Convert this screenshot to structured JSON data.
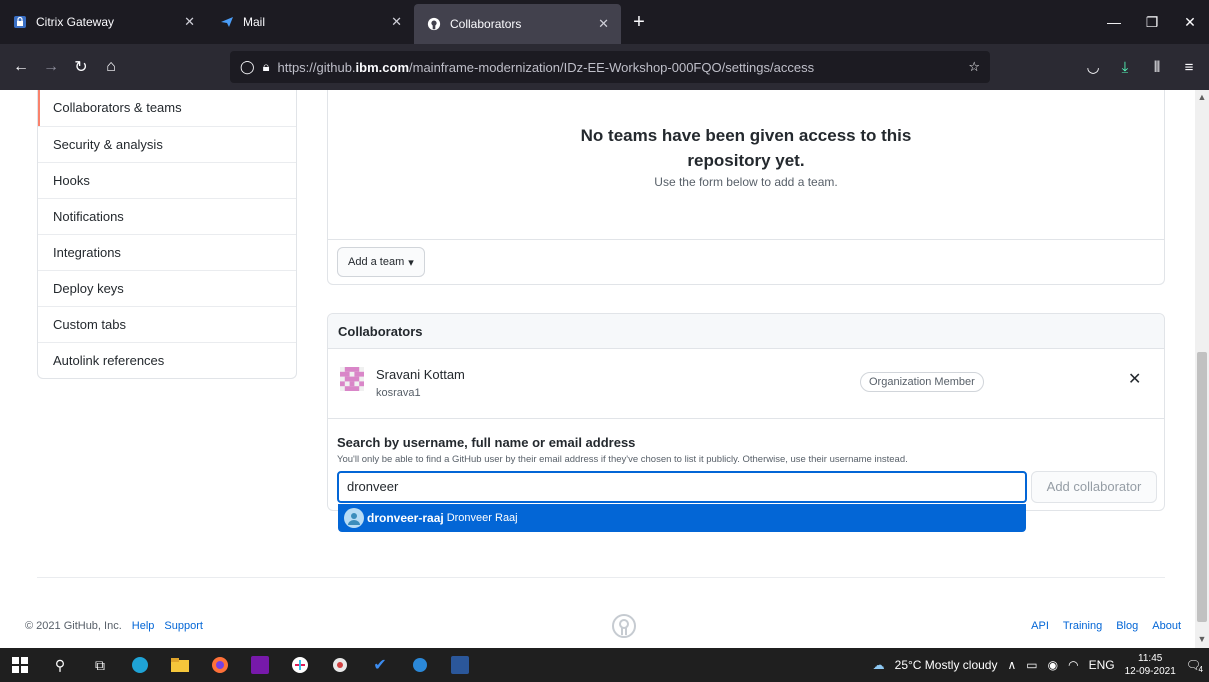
{
  "browser": {
    "tabs": [
      {
        "title": "Citrix Gateway",
        "icon": "lock-icon"
      },
      {
        "title": "Mail",
        "icon": "mail-icon"
      },
      {
        "title": "Collaborators",
        "icon": "github-icon",
        "active": true
      }
    ],
    "url_prefix": "https://github.",
    "url_domain": "ibm.com",
    "url_path": "/mainframe-modernization/IDz-EE-Workshop-000FQO/settings/access"
  },
  "sidebar": {
    "items": [
      {
        "label": "Collaborators & teams"
      },
      {
        "label": "Security & analysis"
      },
      {
        "label": "Hooks"
      },
      {
        "label": "Notifications"
      },
      {
        "label": "Integrations"
      },
      {
        "label": "Deploy keys"
      },
      {
        "label": "Custom tabs"
      },
      {
        "label": "Autolink references"
      }
    ]
  },
  "teams": {
    "empty_title": "No teams have been given access to this repository yet.",
    "empty_subtitle": "Use the form below to add a team.",
    "add_team_label": "Add a team"
  },
  "collaborators": {
    "heading": "Collaborators",
    "member": {
      "name": "Sravani Kottam",
      "login": "kosrava1",
      "badge": "Organization Member"
    },
    "search_label": "Search by username, full name or email address",
    "search_note": "You'll only be able to find a GitHub user by their email address if they've chosen to list it publicly. Otherwise, use their username instead.",
    "search_value": "dronveer",
    "add_button": "Add collaborator",
    "suggestion": {
      "login": "dronveer-raaj",
      "name": "Dronveer Raaj"
    }
  },
  "footer": {
    "copyright": "© 2021 GitHub, Inc.",
    "left_links": [
      "Help",
      "Support"
    ],
    "right_links": [
      "API",
      "Training",
      "Blog",
      "About"
    ]
  },
  "taskbar": {
    "weather": "25°C  Mostly cloudy",
    "lang": "ENG",
    "time": "11:45",
    "date": "12-09-2021",
    "notifications": "4"
  },
  "colors": {
    "accent": "#0366d6",
    "selected_border": "#f9826c"
  }
}
